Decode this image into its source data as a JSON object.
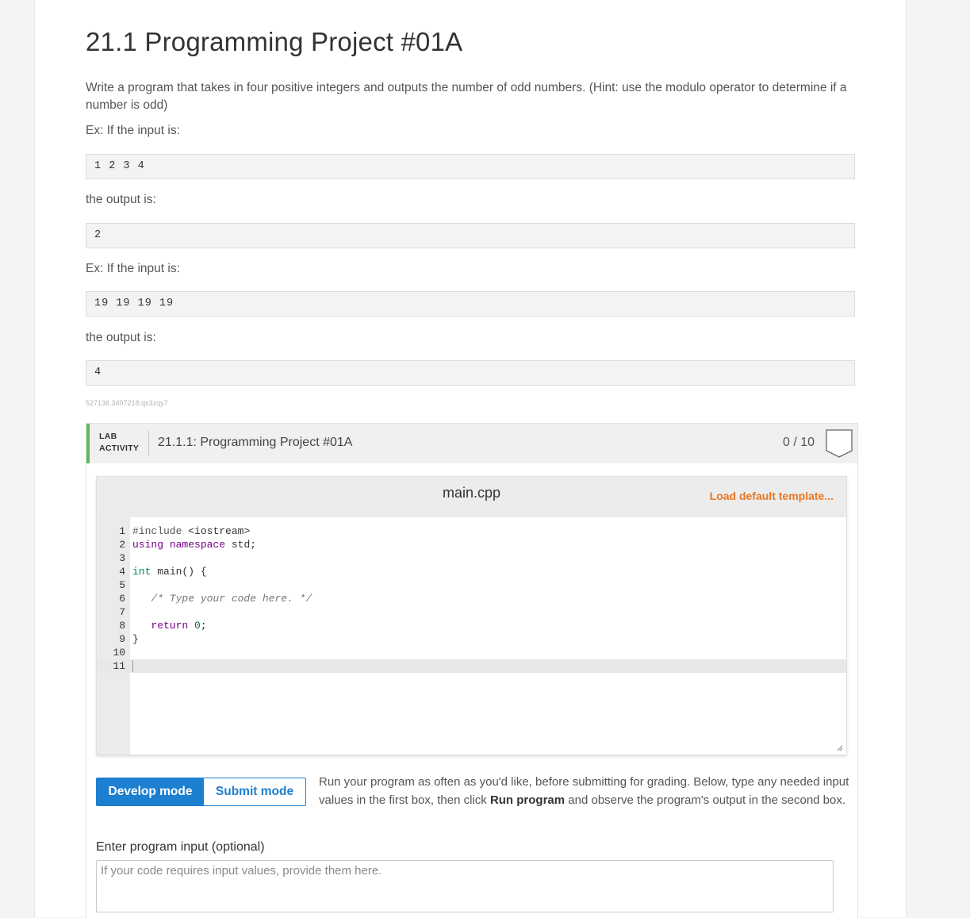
{
  "section": {
    "title": "21.1 Programming Project #01A",
    "description": "Write a program that takes in four positive integers and outputs the number of odd numbers. (Hint: use the modulo operator to determine if a number is odd)",
    "examples": [
      {
        "input_label": "Ex: If the input is:",
        "input": "1 2 3 4",
        "output_label": "the output is:",
        "output": "2"
      },
      {
        "input_label": "Ex: If the input is:",
        "input": "19 19 19 19",
        "output_label": "the output is:",
        "output": "4"
      }
    ],
    "hash": "527136.3497218.qx3zqy7"
  },
  "lab": {
    "tag_line1": "LAB",
    "tag_line2": "ACTIVITY",
    "title": "21.1.1: Programming Project #01A",
    "score": "0 / 10",
    "accent_color": "#5cb85c"
  },
  "editor": {
    "filename": "main.cpp",
    "load_template_label": "Load default template...",
    "line_numbers": [
      "1",
      "2",
      "3",
      "4",
      "5",
      "6",
      "7",
      "8",
      "9",
      "10",
      "11"
    ],
    "active_line": 11
  },
  "modes": {
    "develop_label": "Develop mode",
    "submit_label": "Submit mode",
    "active": "Develop mode",
    "desc_part1": "Run your program as often as you'd like, before submitting for grading. Below, type any needed input values in the first box, then click ",
    "desc_bold": "Run program",
    "desc_part2": " and observe the program's output in the second box."
  },
  "program_input": {
    "label": "Enter program input (optional)",
    "placeholder": "If your code requires input values, provide them here."
  },
  "colors": {
    "primary": "#1d7fd0",
    "link_orange": "#e87722"
  }
}
